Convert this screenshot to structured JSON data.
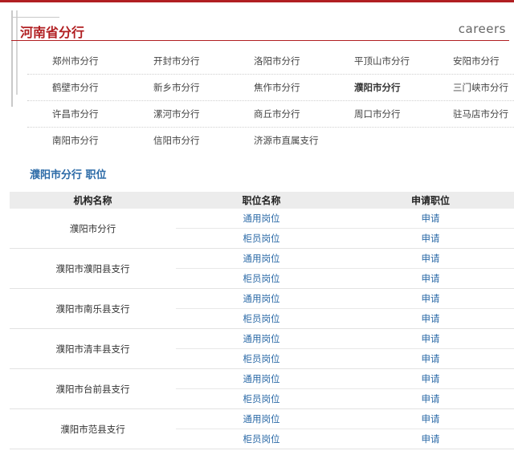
{
  "header": {
    "title": "河南省分行",
    "careers": "careers"
  },
  "branches": [
    [
      "郑州市分行",
      "开封市分行",
      "洛阳市分行",
      "平顶山市分行",
      "安阳市分行"
    ],
    [
      "鹤壁市分行",
      "新乡市分行",
      "焦作市分行",
      "濮阳市分行",
      "三门峡市分行"
    ],
    [
      "许昌市分行",
      "漯河市分行",
      "商丘市分行",
      "周口市分行",
      "驻马店市分行"
    ],
    [
      "南阳市分行",
      "信阳市分行",
      "济源市直属支行"
    ]
  ],
  "active_branch": "濮阳市分行",
  "section_title": "濮阳市分行 职位",
  "table": {
    "headers": [
      "机构名称",
      "职位名称",
      "申请职位"
    ],
    "rows": [
      {
        "org": "濮阳市分行",
        "positions": [
          "通用岗位",
          "柜员岗位"
        ],
        "apply": "申请"
      },
      {
        "org": "濮阳市濮阳县支行",
        "positions": [
          "通用岗位",
          "柜员岗位"
        ],
        "apply": "申请"
      },
      {
        "org": "濮阳市南乐县支行",
        "positions": [
          "通用岗位",
          "柜员岗位"
        ],
        "apply": "申请"
      },
      {
        "org": "濮阳市清丰县支行",
        "positions": [
          "通用岗位",
          "柜员岗位"
        ],
        "apply": "申请"
      },
      {
        "org": "濮阳市台前县支行",
        "positions": [
          "通用岗位",
          "柜员岗位"
        ],
        "apply": "申请"
      },
      {
        "org": "濮阳市范县支行",
        "positions": [
          "通用岗位",
          "柜员岗位"
        ],
        "apply": "申请"
      }
    ]
  },
  "colors": {
    "brand_red": "#b11f22",
    "link_blue": "#2b6aa7",
    "header_bg": "#ececec"
  }
}
